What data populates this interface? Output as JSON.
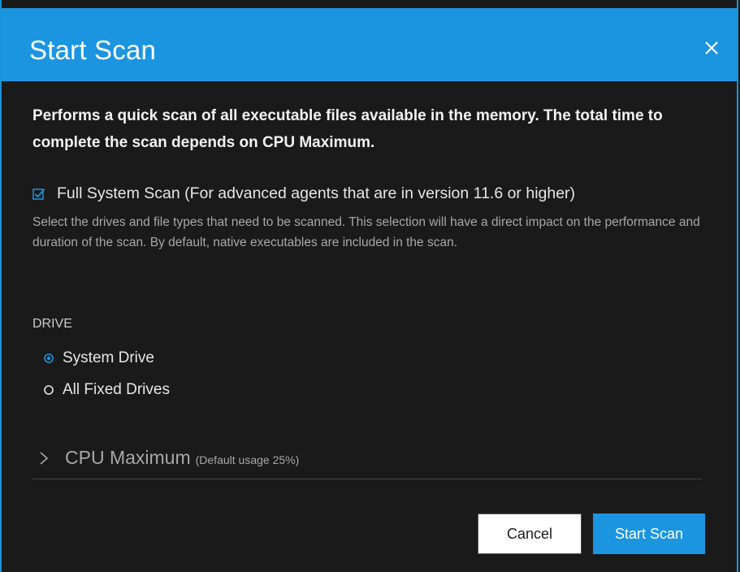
{
  "dialog": {
    "title": "Start Scan",
    "close_icon": "close-icon",
    "intro": "Performs a quick scan of all executable files available in the memory. The total time to complete the scan depends on CPU Maximum.",
    "full_scan": {
      "label": "Full System Scan (For advanced agents that are in version 11.6 or higher)",
      "checked": true,
      "help": "Select the drives and file types that need to be scanned. This selection will have a direct impact on the performance and duration of the scan. By default, native executables are included in the scan."
    },
    "drive": {
      "label": "DRIVE",
      "options": [
        {
          "label": "System Drive",
          "selected": true
        },
        {
          "label": "All Fixed Drives",
          "selected": false
        }
      ]
    },
    "cpu": {
      "title": "CPU Maximum",
      "subtitle": "(Default usage 25%)",
      "expanded": false
    },
    "buttons": {
      "cancel": "Cancel",
      "start": "Start Scan"
    }
  },
  "colors": {
    "accent": "#1b95e0",
    "background": "#1a1a1a",
    "text": "#f2f2f2",
    "muted": "#a8a8a8"
  }
}
